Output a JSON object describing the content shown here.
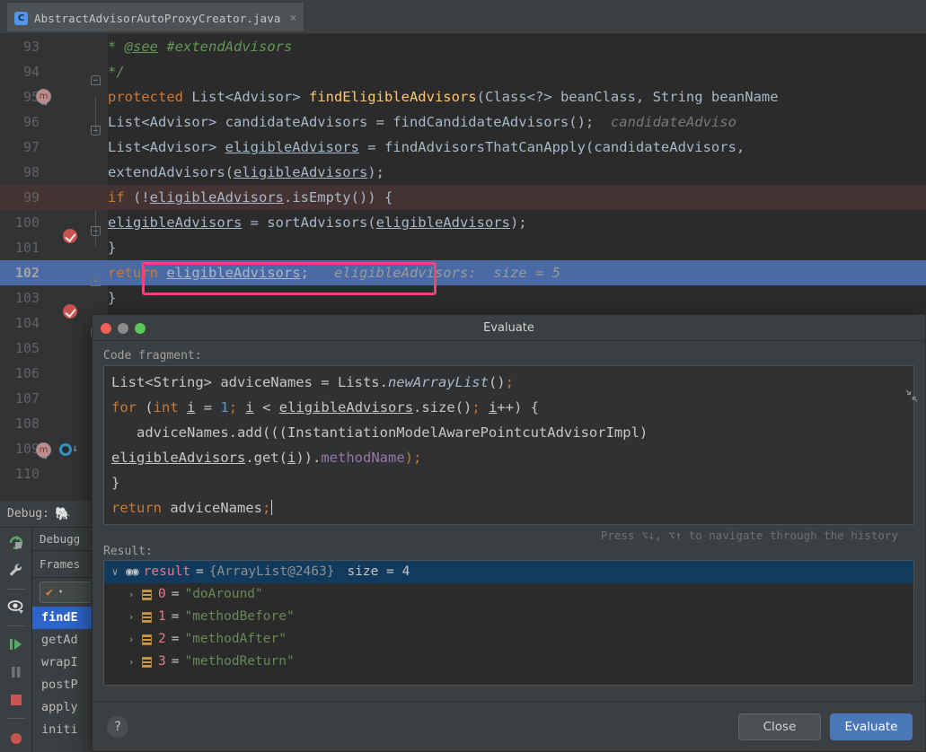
{
  "window": {
    "tab": {
      "label": "AbstractAdvisorAutoProxyCreator.java",
      "icon": "java-class-icon",
      "class_letter": "C",
      "close": "×"
    }
  },
  "editor": {
    "lines": [
      {
        "num": "93",
        "code_html": "          <span class='cmt'>* <u>@see</u> #extendAdvisors</span>"
      },
      {
        "num": "94",
        "code_html": "          <span class='cmt'>*/</span>"
      },
      {
        "num": "95",
        "code_html": "        <span class='k'>protected</span> List&lt;Advisor&gt; <span class='fn'>findEligibleAdvisors</span>(Class&lt;?&gt; beanClass, String beanName"
      },
      {
        "num": "96",
        "code_html": "            List&lt;Advisor&gt; candidateAdvisors = findCandidateAdvisors();&nbsp;&nbsp;<span class='hint'>candidateAdviso</span>"
      },
      {
        "num": "97",
        "code_html": "            List&lt;Advisor&gt; <span class='fld'>eligibleAdvisors</span> = findAdvisorsThatCanApply(candidateAdvisors,"
      },
      {
        "num": "98",
        "code_html": "            extendAdvisors(<span class='fld'>eligibleAdvisors</span>);"
      },
      {
        "num": "99",
        "code_html": "            <span class='k'>if</span> (!<span class='fld'>eligibleAdvisors</span>.isEmpty()) {"
      },
      {
        "num": "100",
        "code_html": "                <span class='fld'>eligibleAdvisors</span> = sortAdvisors(<span class='fld'>eligibleAdvisors</span>);"
      },
      {
        "num": "101",
        "code_html": "            }"
      },
      {
        "num": "102",
        "code_html": "            <span class='k'>return</span> <span class='fld'>eligibleAdvisors</span>;&nbsp;&nbsp;&nbsp;<span class='hint-b'>eligibleAdvisors:&nbsp; size = 5</span>"
      },
      {
        "num": "103",
        "code_html": "        }"
      },
      {
        "num": "104",
        "code_html": ""
      },
      {
        "num": "105",
        "code_html": ""
      },
      {
        "num": "106",
        "code_html": ""
      },
      {
        "num": "107",
        "code_html": ""
      },
      {
        "num": "108",
        "code_html": ""
      },
      {
        "num": "109",
        "code_html": ""
      },
      {
        "num": "110",
        "code_html": ""
      }
    ],
    "inline_hint_line102": "eligibleAdvisors:  size = 5",
    "inline_hint_line96": "candidateAdviso",
    "breakpoint_lines": [
      "99",
      "102"
    ],
    "current_line": "102",
    "method_marker_lines": [
      "95",
      "109"
    ],
    "override_marker_lines": [
      "109"
    ]
  },
  "annotations": {
    "color": "#f4427e",
    "boxes": [
      "return-statement-highlight",
      "result-panel-highlight"
    ]
  },
  "debug_panel": {
    "title": "Debug:",
    "run_config_icon": "elephant-icon",
    "tabs": [
      "Debugg"
    ],
    "frames_label": "Frames",
    "thread_selector": {
      "check": "✔",
      "caret": "▾"
    },
    "frames": [
      {
        "label": "findE",
        "selected": true
      },
      {
        "label": "getAd",
        "selected": false
      },
      {
        "label": "wrapI",
        "selected": false
      },
      {
        "label": "postP",
        "selected": false
      },
      {
        "label": "apply",
        "selected": false
      },
      {
        "label": "initi",
        "selected": false
      }
    ],
    "tool_buttons": [
      "rerun-icon",
      "settings-wrench-icon",
      "mute-breakpoints-eye-icon",
      "resume-program-icon",
      "pause-program-icon",
      "stop-icon"
    ]
  },
  "dialog": {
    "title": "Evaluate",
    "traffic_lights": [
      "close",
      "minimize",
      "zoom"
    ],
    "code_fragment_label": "Code fragment:",
    "code_fragment_lines": [
      "<span class='rplain'>List&lt;String&gt; adviceNames = Lists.</span><span style='color:#a9b7c6;font-style:italic'>newArrayList</span><span class='rplain'>()</span><span class='k'>;</span>",
      "<span class='k'>for</span><span class='rplain'> (</span><span class='k'>int</span><span class='rplain'> <u>i</u> = </span><span class='num'>1</span><span class='k'>;</span><span class='rplain'> <u>i</u> &lt; <u>eligibleAdvisors</u>.size()</span><span class='k'>;</span><span class='rplain'> <u>i</u>++) {</span>",
      "<span class='rplain'>&nbsp;&nbsp;&nbsp;adviceNames.add(((InstantiationModelAwarePointcutAdvisorImpl)</span>",
      "<span class='rplain'><u>eligibleAdvisors</u>.get(<u>i</u>)).</span><span style='color:#9876aa'>methodName</span><span class='k'>)</span><span class='k'>;</span>",
      "<span class='rplain'>}</span>",
      "<span class='k'>return</span><span class='rplain'> adviceNames</span><span class='k'>;</span>"
    ],
    "code_fragment_plain": "List<String> adviceNames = Lists.newArrayList();\nfor (int i = 1; i < eligibleAdvisors.size(); i++) {\n    adviceNames.add(((InstantiationModelAwarePointcutAdvisorImpl)\n eligibleAdvisors.get(i)).methodName);\n}\nreturn adviceNames;",
    "history_hint": "Press ⌥↓, ⌥↑ to navigate through the history",
    "shrink_icon": "collapse-icon",
    "result_label": "Result:",
    "result_root": {
      "twisty": "∨",
      "icon": "watch-glasses-icon",
      "name": "result",
      "eq": "=",
      "type": "{ArrayList@2463}",
      "size": "size = 4"
    },
    "result_children": [
      {
        "twisty": "〉",
        "icon": "list-element-icon",
        "index": "0",
        "eq": "=",
        "value": "\"doAround\""
      },
      {
        "twisty": "〉",
        "icon": "list-element-icon",
        "index": "1",
        "eq": "=",
        "value": "\"methodBefore\""
      },
      {
        "twisty": "〉",
        "icon": "list-element-icon",
        "index": "2",
        "eq": "=",
        "value": "\"methodAfter\""
      },
      {
        "twisty": "〉",
        "icon": "list-element-icon",
        "index": "3",
        "eq": "=",
        "value": "\"methodReturn\""
      }
    ],
    "help_label": "?",
    "close_label": "Close",
    "evaluate_label": "Evaluate"
  }
}
